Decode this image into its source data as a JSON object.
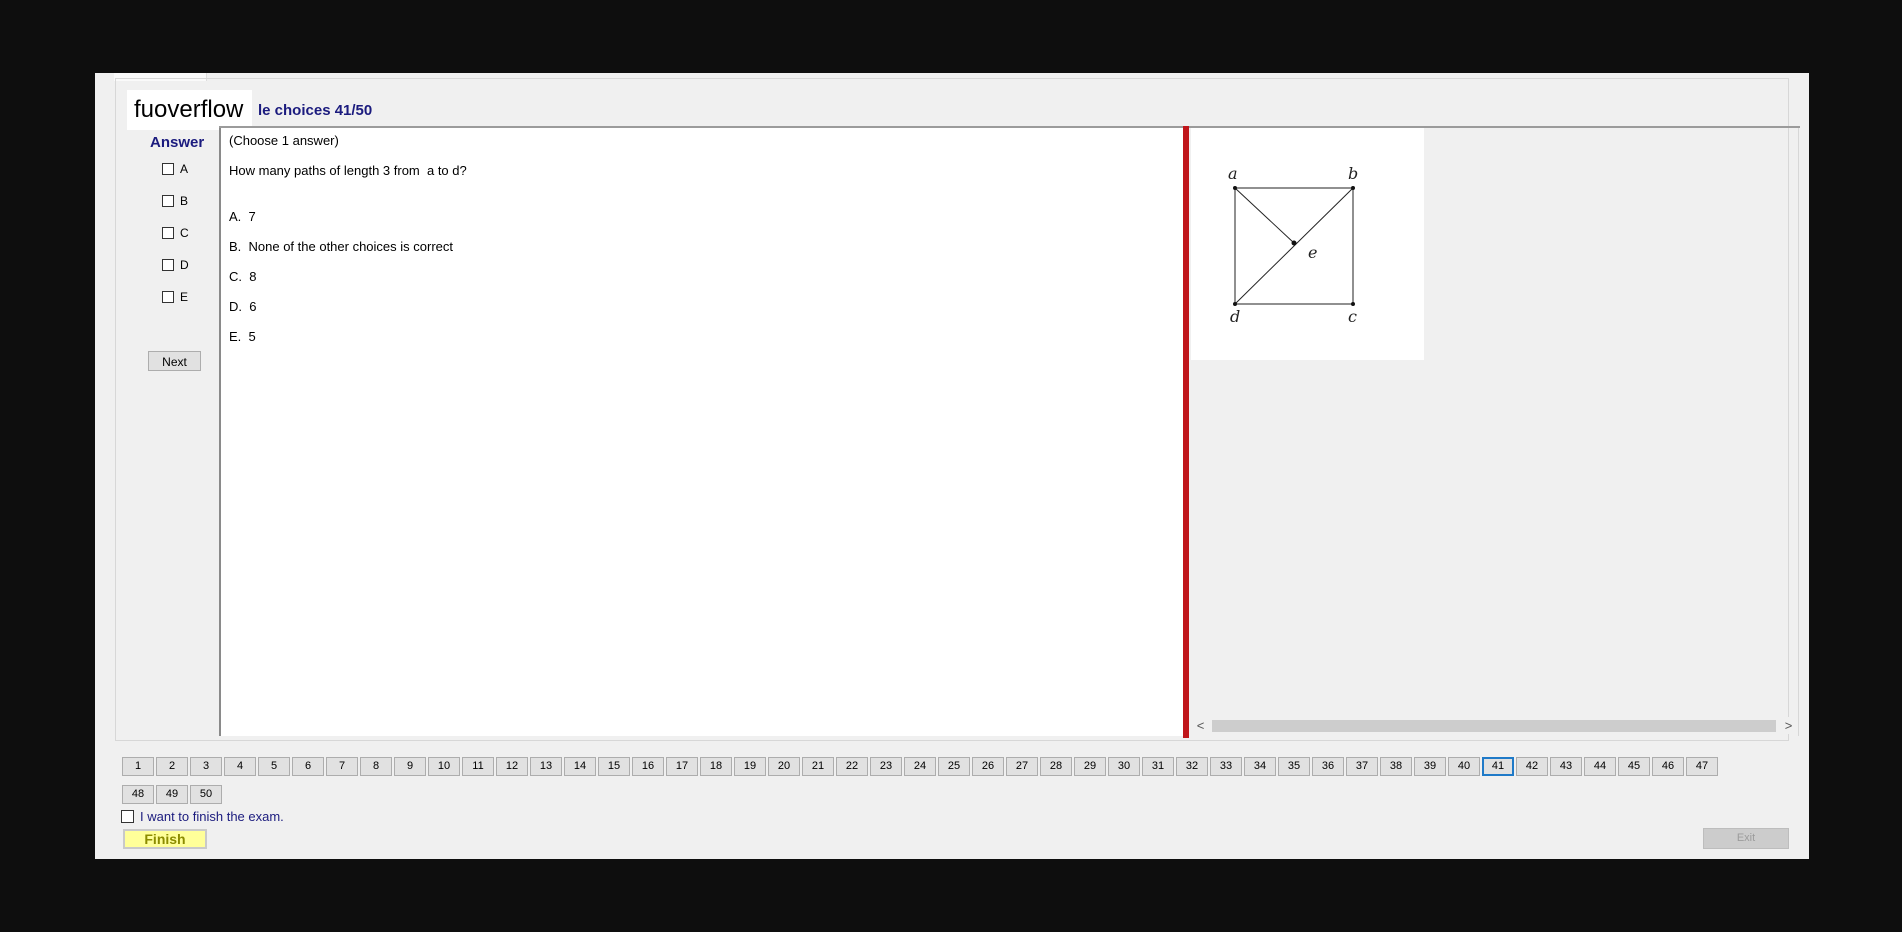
{
  "header": {
    "logo_text": "fuoverflow",
    "title": "le choices 41/50"
  },
  "answer_panel": {
    "label": "Answer",
    "options": [
      "A",
      "B",
      "C",
      "D",
      "E"
    ],
    "next_label": "Next"
  },
  "question": {
    "instruction": "(Choose 1 answer)",
    "prompt": "How many paths of length 3 from  a to d?",
    "choices": [
      "A.  7",
      "B.  None of the other choices is correct",
      "C.  8",
      "D.  6",
      "E.  5"
    ]
  },
  "figure": {
    "vertex_labels": [
      "a",
      "b",
      "e",
      "d",
      "c"
    ]
  },
  "scrollbar": {
    "left_arrow": "<",
    "right_arrow": ">"
  },
  "question_nav": {
    "numbers": [
      "1",
      "2",
      "3",
      "4",
      "5",
      "6",
      "7",
      "8",
      "9",
      "10",
      "11",
      "12",
      "13",
      "14",
      "15",
      "16",
      "17",
      "18",
      "19",
      "20",
      "21",
      "22",
      "23",
      "24",
      "25",
      "26",
      "27",
      "28",
      "29",
      "30",
      "31",
      "32",
      "33",
      "34",
      "35",
      "36",
      "37",
      "38",
      "39",
      "40",
      "41",
      "42",
      "43",
      "44",
      "45",
      "46",
      "47",
      "48",
      "49",
      "50"
    ],
    "current": "41"
  },
  "footer": {
    "finish_checkbox_label": "I want to finish the exam.",
    "finish_button": "Finish",
    "exit_button": "Exit"
  },
  "colors": {
    "accent_text": "#1b1b7e",
    "splitter": "#c0161b",
    "active_border": "#1f7ac8",
    "finish_bg": "#ffff99"
  }
}
